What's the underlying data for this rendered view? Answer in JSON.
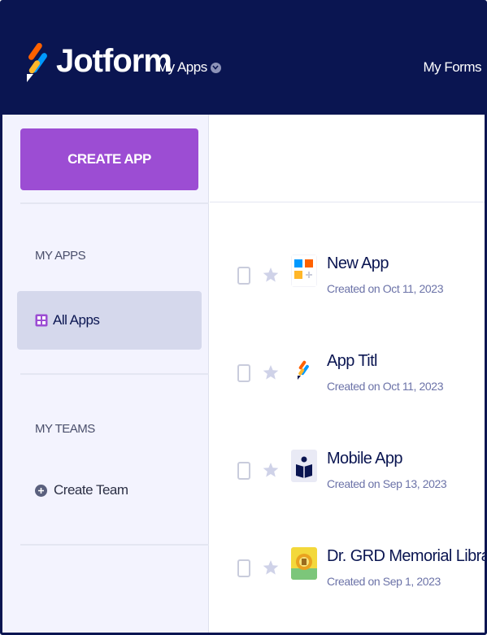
{
  "header": {
    "logo_text": "Jotform",
    "apps_dropdown_label": "My Apps",
    "my_forms_label": "My Forms"
  },
  "sidebar": {
    "create_button_label": "CREATE APP",
    "my_apps_heading": "MY APPS",
    "all_apps_label": "All Apps",
    "my_teams_heading": "MY TEAMS",
    "create_team_label": "Create Team"
  },
  "apps": [
    {
      "title": "New App",
      "created": "Created on Oct 11, 2023",
      "icon": "new-app-grid-icon"
    },
    {
      "title": "App Titl",
      "created": "Created on Oct 11, 2023",
      "icon": "jotform-logo-icon"
    },
    {
      "title": "Mobile App",
      "created": "Created on Sep 13, 2023",
      "icon": "reader-book-icon"
    },
    {
      "title": "Dr. GRD Memorial Library",
      "created": "Created on Sep 1, 2023",
      "icon": "library-emblem-icon"
    }
  ],
  "colors": {
    "header_bg": "#0a1551",
    "create_button": "#9c4dd3",
    "sidebar_bg": "#f3f3fe",
    "selected_item_bg": "#d5d8ec"
  }
}
